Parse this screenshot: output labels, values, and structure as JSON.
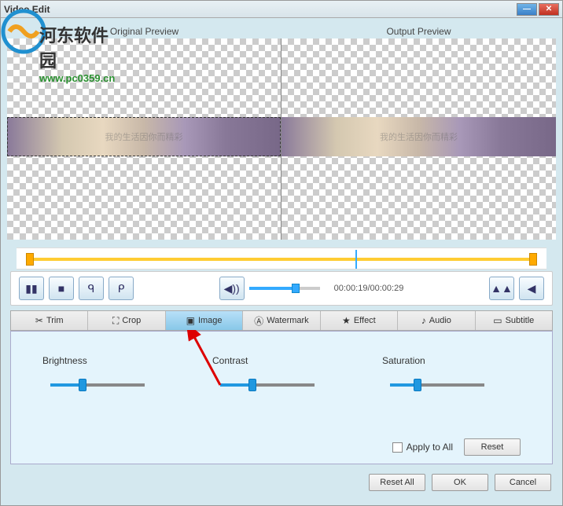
{
  "titlebar": {
    "title": "Video Edit"
  },
  "watermark": {
    "cn": "河东软件园",
    "url": "www.pc0359.cn"
  },
  "preview": {
    "original_label": "Original Preview",
    "output_label": "Output Preview",
    "strip_text": "我的生活因你而精彩"
  },
  "controls": {
    "time": "00:00:19/00:00:29"
  },
  "tabs": {
    "trim": "Trim",
    "crop": "Crop",
    "image": "Image",
    "watermark": "Watermark",
    "effect": "Effect",
    "audio": "Audio",
    "subtitle": "Subtitle"
  },
  "settings": {
    "brightness": {
      "label": "Brightness",
      "value": 30
    },
    "contrast": {
      "label": "Contrast",
      "value": 30
    },
    "saturation": {
      "label": "Saturation",
      "value": 25
    },
    "apply_all": "Apply to All",
    "reset": "Reset"
  },
  "footer": {
    "reset_all": "Reset All",
    "ok": "OK",
    "cancel": "Cancel"
  }
}
